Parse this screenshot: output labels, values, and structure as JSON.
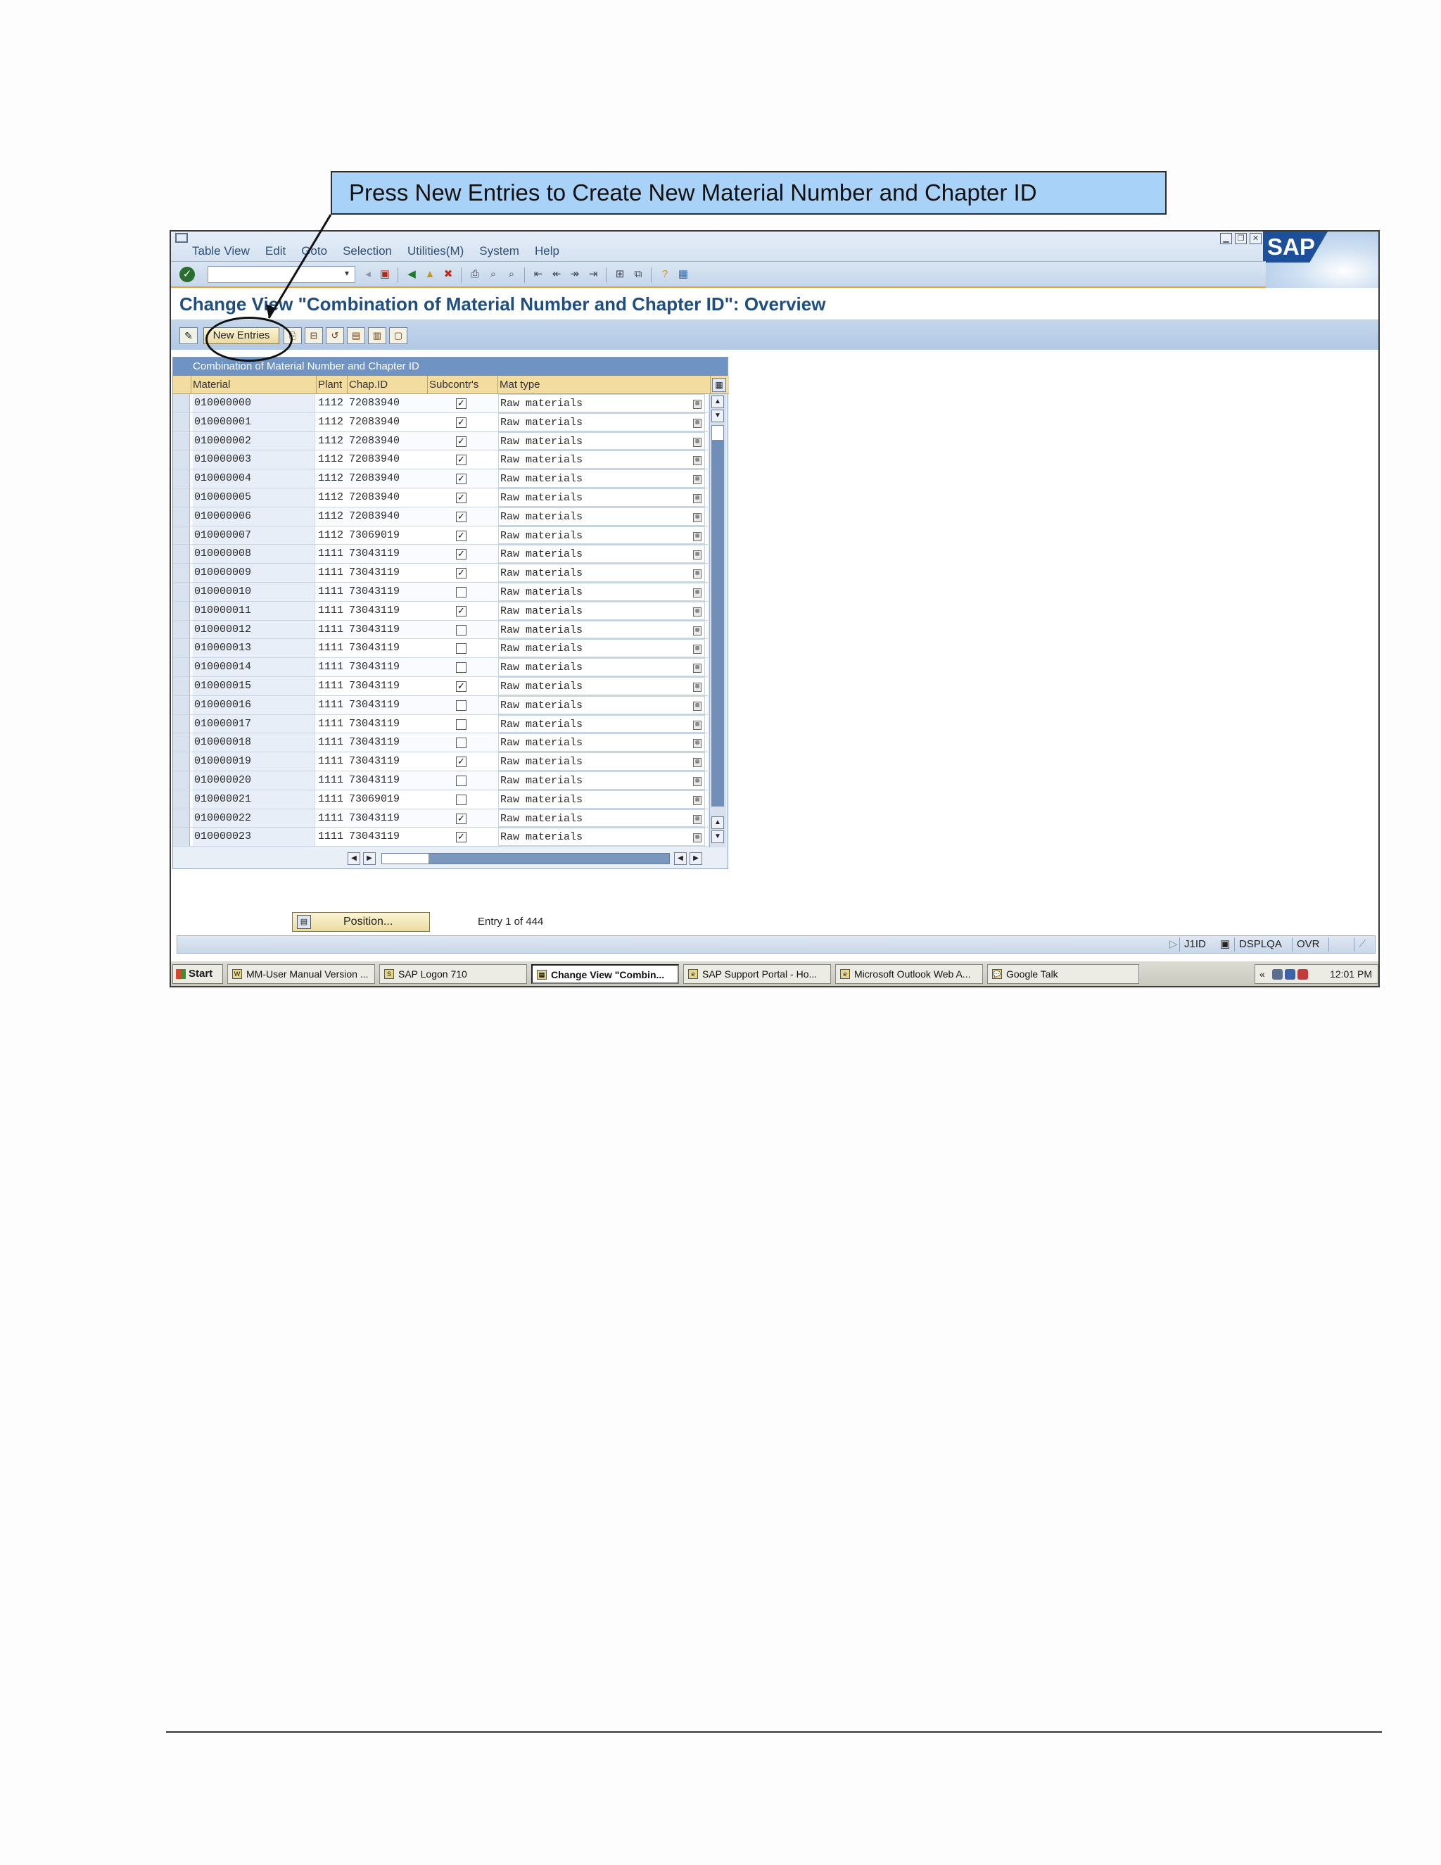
{
  "callout": {
    "text": "Press New Entries to Create New Material Number and Chapter ID"
  },
  "menu": [
    "Table View",
    "Edit",
    "Goto",
    "Selection",
    "Utilities(M)",
    "System",
    "Help"
  ],
  "brand": {
    "logo_text": "SAP",
    "accent": "#1d4f9a"
  },
  "window_controls": [
    "minimize-icon",
    "restore-icon",
    "close-icon"
  ],
  "toolbar": {
    "command_value": "",
    "icons": [
      "enter-icon",
      "save-icon",
      "back-icon",
      "exit-icon",
      "cancel-icon",
      "print-icon",
      "find-icon",
      "find-next-icon",
      "first-page-icon",
      "previous-page-icon",
      "next-page-icon",
      "last-page-icon",
      "create-session-icon",
      "shortcut-icon",
      "help-icon",
      "layout-icon"
    ]
  },
  "page": {
    "title": "Change View \"Combination of Material Number and Chapter ID\": Overview"
  },
  "app_toolbar": {
    "new_entries_label": "New Entries"
  },
  "table": {
    "caption": "Combination of Material Number and Chapter ID",
    "headers": {
      "material": "Material",
      "plant": "Plant",
      "chap_id": "Chap.ID",
      "subcontr": "Subcontr's",
      "mat_type": "Mat type"
    },
    "rows": [
      {
        "material": "010000000",
        "plant": "1112",
        "chap_id": "72083940",
        "subcontr": true,
        "mat_type": "Raw materials"
      },
      {
        "material": "010000001",
        "plant": "1112",
        "chap_id": "72083940",
        "subcontr": true,
        "mat_type": "Raw materials"
      },
      {
        "material": "010000002",
        "plant": "1112",
        "chap_id": "72083940",
        "subcontr": true,
        "mat_type": "Raw materials"
      },
      {
        "material": "010000003",
        "plant": "1112",
        "chap_id": "72083940",
        "subcontr": true,
        "mat_type": "Raw materials"
      },
      {
        "material": "010000004",
        "plant": "1112",
        "chap_id": "72083940",
        "subcontr": true,
        "mat_type": "Raw materials"
      },
      {
        "material": "010000005",
        "plant": "1112",
        "chap_id": "72083940",
        "subcontr": true,
        "mat_type": "Raw materials"
      },
      {
        "material": "010000006",
        "plant": "1112",
        "chap_id": "72083940",
        "subcontr": true,
        "mat_type": "Raw materials"
      },
      {
        "material": "010000007",
        "plant": "1112",
        "chap_id": "73069019",
        "subcontr": true,
        "mat_type": "Raw materials"
      },
      {
        "material": "010000008",
        "plant": "1111",
        "chap_id": "73043119",
        "subcontr": true,
        "mat_type": "Raw materials"
      },
      {
        "material": "010000009",
        "plant": "1111",
        "chap_id": "73043119",
        "subcontr": true,
        "mat_type": "Raw materials"
      },
      {
        "material": "010000010",
        "plant": "1111",
        "chap_id": "73043119",
        "subcontr": false,
        "mat_type": "Raw materials"
      },
      {
        "material": "010000011",
        "plant": "1111",
        "chap_id": "73043119",
        "subcontr": true,
        "mat_type": "Raw materials"
      },
      {
        "material": "010000012",
        "plant": "1111",
        "chap_id": "73043119",
        "subcontr": false,
        "mat_type": "Raw materials"
      },
      {
        "material": "010000013",
        "plant": "1111",
        "chap_id": "73043119",
        "subcontr": false,
        "mat_type": "Raw materials"
      },
      {
        "material": "010000014",
        "plant": "1111",
        "chap_id": "73043119",
        "subcontr": false,
        "mat_type": "Raw materials"
      },
      {
        "material": "010000015",
        "plant": "1111",
        "chap_id": "73043119",
        "subcontr": true,
        "mat_type": "Raw materials"
      },
      {
        "material": "010000016",
        "plant": "1111",
        "chap_id": "73043119",
        "subcontr": false,
        "mat_type": "Raw materials"
      },
      {
        "material": "010000017",
        "plant": "1111",
        "chap_id": "73043119",
        "subcontr": false,
        "mat_type": "Raw materials"
      },
      {
        "material": "010000018",
        "plant": "1111",
        "chap_id": "73043119",
        "subcontr": false,
        "mat_type": "Raw materials"
      },
      {
        "material": "010000019",
        "plant": "1111",
        "chap_id": "73043119",
        "subcontr": true,
        "mat_type": "Raw materials"
      },
      {
        "material": "010000020",
        "plant": "1111",
        "chap_id": "73043119",
        "subcontr": false,
        "mat_type": "Raw materials"
      },
      {
        "material": "010000021",
        "plant": "1111",
        "chap_id": "73069019",
        "subcontr": false,
        "mat_type": "Raw materials"
      },
      {
        "material": "010000022",
        "plant": "1111",
        "chap_id": "73043119",
        "subcontr": true,
        "mat_type": "Raw materials"
      },
      {
        "material": "010000023",
        "plant": "1111",
        "chap_id": "73043119",
        "subcontr": true,
        "mat_type": "Raw materials"
      }
    ]
  },
  "position": {
    "button_label": "Position...",
    "entry_info": "Entry 1 of 444"
  },
  "status_bar": {
    "system": "J1ID",
    "client_host": "DSPLQA",
    "mode": "OVR"
  },
  "taskbar": {
    "start_label": "Start",
    "tasks": [
      {
        "label": "MM-User Manual Version ...",
        "active": false
      },
      {
        "label": "SAP Logon 710",
        "active": false
      },
      {
        "label": "Change View \"Combin...",
        "active": true
      },
      {
        "label": "SAP Support Portal - Ho...",
        "active": false
      },
      {
        "label": "Microsoft Outlook Web A...",
        "active": false
      },
      {
        "label": "Google Talk",
        "active": false
      }
    ],
    "tray_chevron": "«",
    "clock": "12:01 PM"
  }
}
